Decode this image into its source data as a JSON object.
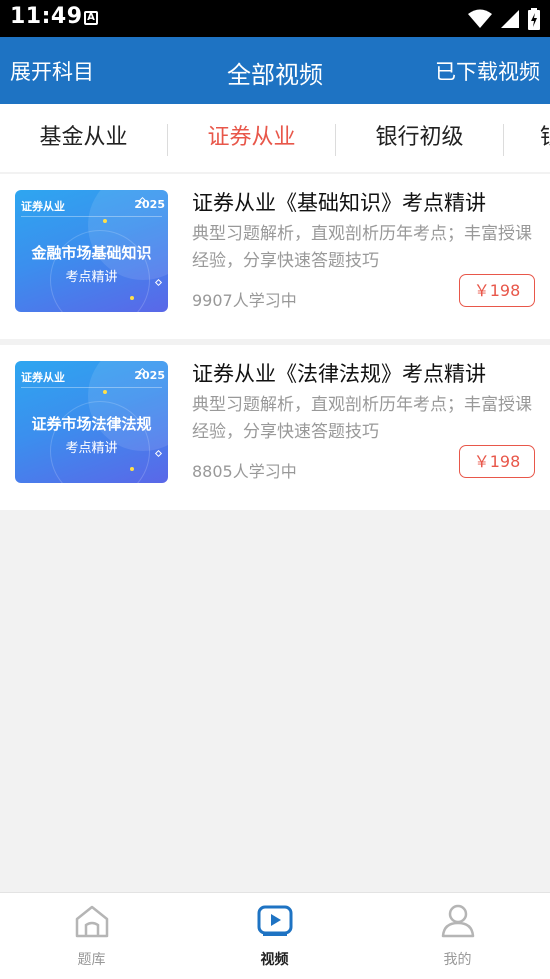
{
  "status_bar": {
    "time": "11:49",
    "notification_letter": "A"
  },
  "header": {
    "left_label": "展开科目",
    "title": "全部视频",
    "right_label": "已下载视频"
  },
  "tabs": [
    {
      "label": "基金从业"
    },
    {
      "label": "证券从业"
    },
    {
      "label": "银行初级"
    },
    {
      "label": "银"
    }
  ],
  "courses": [
    {
      "thumb_tag": "证券从业",
      "thumb_year": "2025",
      "thumb_title": "金融市场基础知识",
      "thumb_sub": "考点精讲",
      "title": "证券从业《基础知识》考点精讲",
      "desc": "典型习题解析，直观剖析历年考点；丰富授课经验，分享快速答题技巧",
      "count": "9907人学习中",
      "price": "￥198"
    },
    {
      "thumb_tag": "证券从业",
      "thumb_year": "2025",
      "thumb_title": "证券市场法律法规",
      "thumb_sub": "考点精讲",
      "title": "证券从业《法律法规》考点精讲",
      "desc": "典型习题解析，直观剖析历年考点；丰富授课经验，分享快速答题技巧",
      "count": "8805人学习中",
      "price": "￥198"
    }
  ],
  "bottom_nav": [
    {
      "label": "题库",
      "icon": "home-icon"
    },
    {
      "label": "视频",
      "icon": "video-icon"
    },
    {
      "label": "我的",
      "icon": "user-icon"
    }
  ],
  "colors": {
    "header_bg": "#1e73c3",
    "accent": "#e8574a",
    "nav_active": "#1e73c3"
  }
}
